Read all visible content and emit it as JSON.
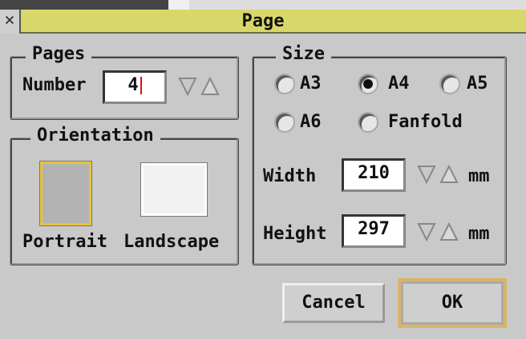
{
  "window": {
    "title": "Page",
    "close_glyph": "×"
  },
  "pages": {
    "group_label": "Pages",
    "number_label": "Number",
    "number_value": "4"
  },
  "orientation": {
    "group_label": "Orientation",
    "portrait_label": "Portrait",
    "landscape_label": "Landscape",
    "selected": "Portrait"
  },
  "size": {
    "group_label": "Size",
    "options": [
      "A3",
      "A4",
      "A5",
      "A6",
      "Fanfold"
    ],
    "selected": "A4",
    "width_label": "Width",
    "width_value": "210",
    "height_label": "Height",
    "height_value": "297",
    "unit": "mm"
  },
  "buttons": {
    "cancel": "Cancel",
    "ok": "OK"
  },
  "icons": {
    "adjusters": "down-up-arrow-icon",
    "close": "close-icon"
  },
  "colors": {
    "titlebar": "#d8d86a",
    "selected_tile": "#b3b3b3",
    "tile_highlight": "#e8c23a",
    "window_bg": "#c9c9c9"
  }
}
